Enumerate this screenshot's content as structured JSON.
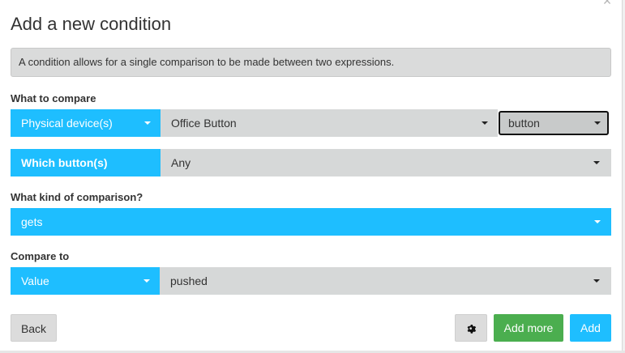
{
  "dialog": {
    "title": "Add a new condition",
    "close_icon": "close-icon",
    "info_text": "A condition allows for a single comparison to be made between two expressions."
  },
  "what_to_compare": {
    "label": "What to compare",
    "source_type": "Physical device(s)",
    "device": "Office Button",
    "device_kind": "button",
    "which_label": "Which button(s)",
    "which_value": "Any"
  },
  "comparison": {
    "label": "What kind of comparison?",
    "value": "gets"
  },
  "compare_to": {
    "label": "Compare to",
    "type": "Value",
    "value": "pushed"
  },
  "buttons": {
    "back": "Back",
    "settings_icon": "gear-icon",
    "add_more": "Add more",
    "add": "Add"
  },
  "colors": {
    "accent_blue": "#1ebeff",
    "success_green": "#4bae4f",
    "select_gray": "#d6d8d8"
  }
}
